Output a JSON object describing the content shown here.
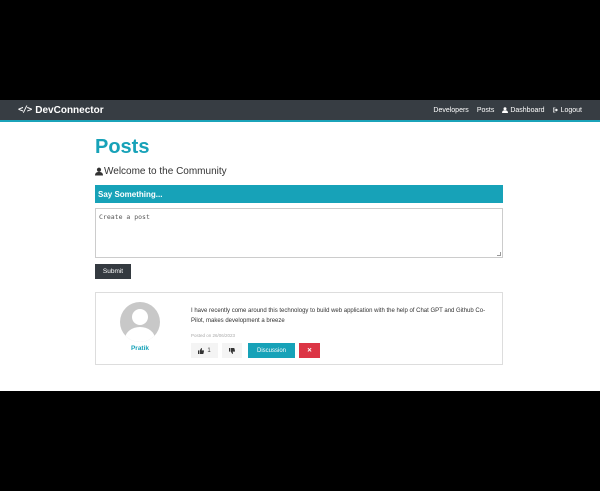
{
  "navbar": {
    "brand": "DevConnector",
    "brand_icon": "code-icon",
    "links": {
      "developers": "Developers",
      "posts": "Posts",
      "dashboard": "Dashboard",
      "logout": "Logout"
    }
  },
  "main": {
    "title": "Posts",
    "welcome": "Welcome to the Community",
    "form": {
      "header": "Say Something...",
      "placeholder": "Create a post",
      "submit_label": "Submit"
    },
    "posts": [
      {
        "author": "Pratik",
        "text": "I have recently come around this technology to build web application with the help of Chat GPT and Github Co-Pilot, makes development a breeze",
        "date": "Posted on 26/06/2023",
        "likes": "1",
        "discussion_label": "Discussion",
        "delete_label": "✕"
      }
    ]
  },
  "colors": {
    "primary": "#17a2b8",
    "dark": "#343a40",
    "danger": "#dc3545"
  }
}
